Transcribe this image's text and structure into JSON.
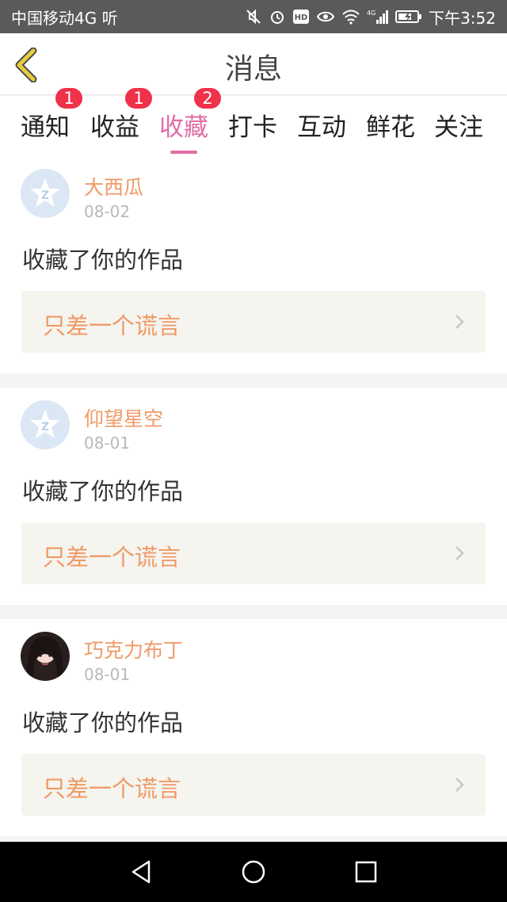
{
  "status_bar": {
    "carrier": "中国移动4G 听",
    "time": "下午3:52",
    "icons": [
      "mute-icon",
      "alarm-icon",
      "hd-icon",
      "eye-icon",
      "wifi-icon",
      "signal-4g-icon",
      "battery-charging-icon"
    ]
  },
  "header": {
    "title": "消息",
    "back_icon": "chevron-left-icon"
  },
  "tabs": [
    {
      "label": "通知",
      "badge": "1"
    },
    {
      "label": "收益",
      "badge": "1"
    },
    {
      "label": "收藏",
      "badge": "2",
      "active": true
    },
    {
      "label": "打卡",
      "badge": ""
    },
    {
      "label": "互动",
      "badge": ""
    },
    {
      "label": "鲜花",
      "badge": ""
    },
    {
      "label": "关注",
      "badge": ""
    }
  ],
  "messages": [
    {
      "user": "大西瓜",
      "date": "08-02",
      "text": "收藏了你的作品",
      "work_title": "只差一个谎言",
      "avatar": "default-avatar-icon"
    },
    {
      "user": "仰望星空",
      "date": "08-01",
      "text": "收藏了你的作品",
      "work_title": "只差一个谎言",
      "avatar": "default-avatar-icon"
    },
    {
      "user": "巧克力布丁",
      "date": "08-01",
      "text": "收藏了你的作品",
      "work_title": "只差一个谎言",
      "avatar": "user-photo"
    }
  ],
  "nav": {
    "back_icon": "nav-back-icon",
    "home_icon": "nav-home-icon",
    "recents_icon": "nav-recents-icon"
  },
  "colors": {
    "accent": "#e06ca6",
    "badge": "#f0314a",
    "username": "#ef9a67",
    "status_bar": "#5a5a5a",
    "back_arrow": "#e8cc3b"
  }
}
